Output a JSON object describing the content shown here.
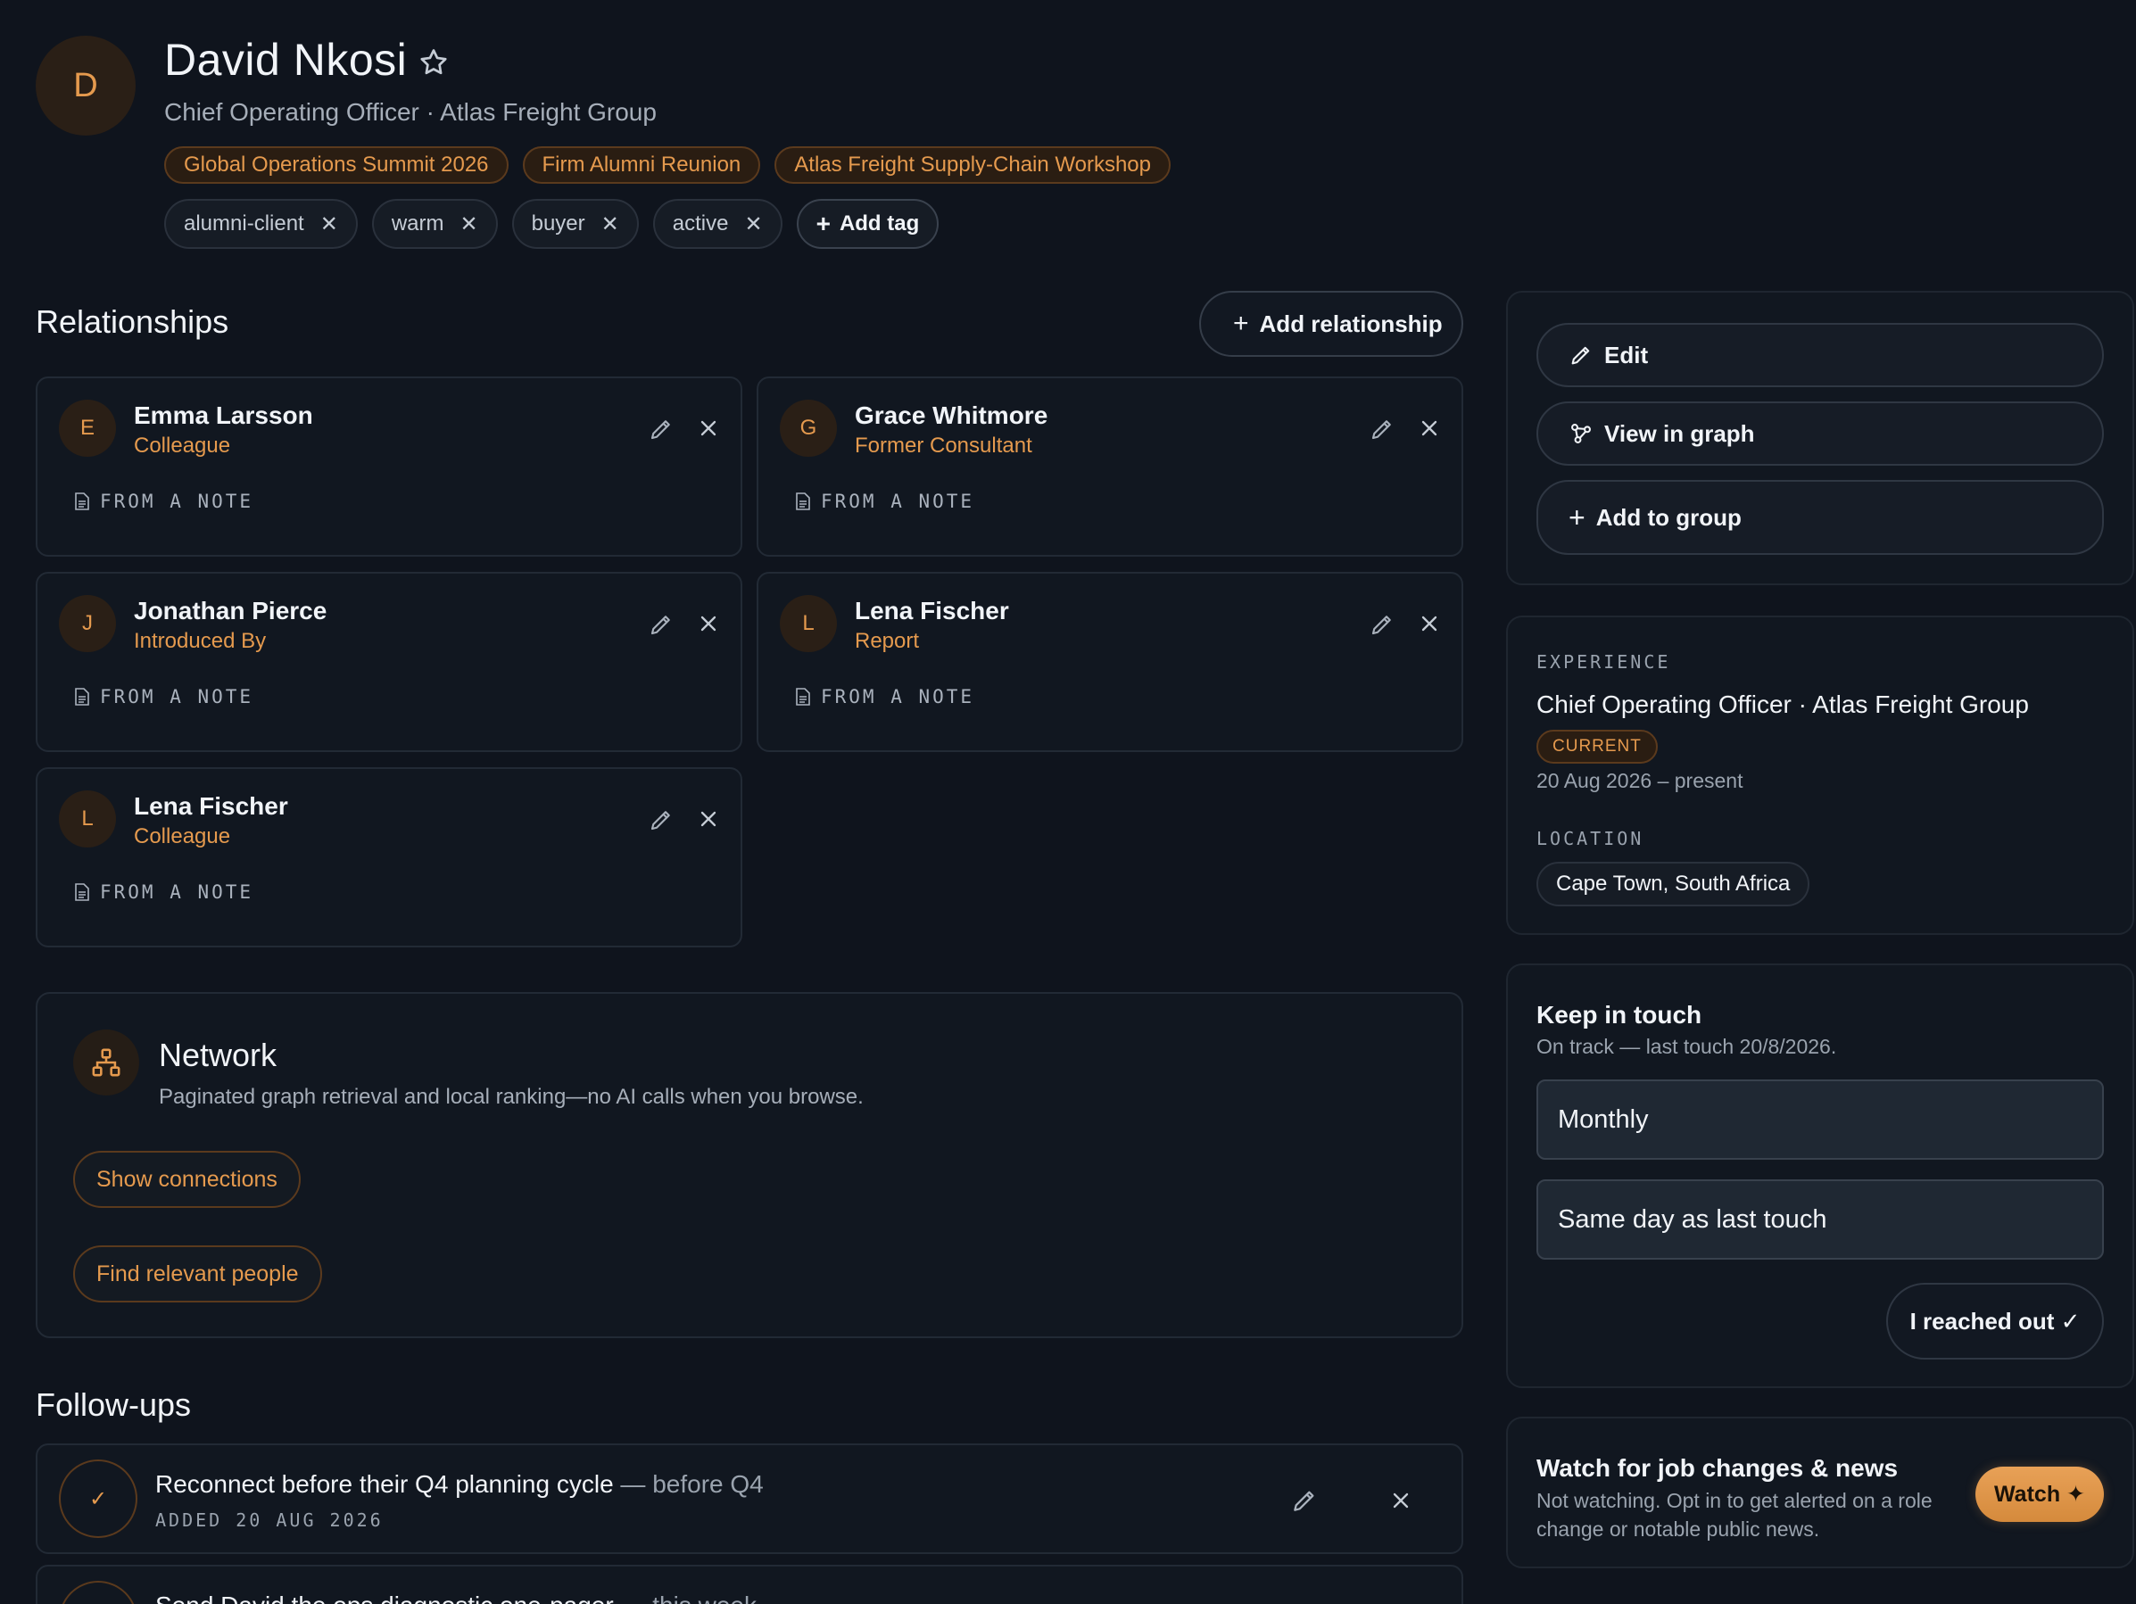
{
  "profile": {
    "avatar_letter": "D",
    "name": "David Nkosi",
    "subtitle": "Chief Operating Officer · Atlas Freight Group",
    "events": [
      "Global Operations Summit 2026",
      "Firm Alumni Reunion",
      "Atlas Freight Supply-Chain Workshop"
    ],
    "tags": [
      "alumni-client",
      "warm",
      "buyer",
      "active"
    ],
    "add_tag_label": "Add tag"
  },
  "relationships": {
    "title": "Relationships",
    "add_label": "Add relationship",
    "source_label": "FROM A NOTE",
    "items": [
      {
        "letter": "E",
        "name": "Emma Larsson",
        "role": "Colleague"
      },
      {
        "letter": "G",
        "name": "Grace Whitmore",
        "role": "Former Consultant"
      },
      {
        "letter": "J",
        "name": "Jonathan Pierce",
        "role": "Introduced By"
      },
      {
        "letter": "L",
        "name": "Lena Fischer",
        "role": "Report"
      },
      {
        "letter": "L",
        "name": "Lena Fischer",
        "role": "Colleague"
      }
    ]
  },
  "network": {
    "title": "Network",
    "description": "Paginated graph retrieval and local ranking—no AI calls when you browse.",
    "show_connections": "Show connections",
    "find_people": "Find relevant people"
  },
  "followups": {
    "title": "Follow-ups",
    "items": [
      {
        "text": "Reconnect before their Q4 planning cycle",
        "due": " — before Q4",
        "added": "ADDED 20 AUG 2026"
      },
      {
        "text": "Send David the ops diagnostic one-pager",
        "due": " — this week",
        "added": ""
      }
    ]
  },
  "actions": {
    "edit": "Edit",
    "view_graph": "View in graph",
    "add_group": "Add to group"
  },
  "experience": {
    "label": "EXPERIENCE",
    "role": "Chief Operating Officer · Atlas Freight Group",
    "badge": "CURRENT",
    "dates": "20 Aug 2026 – present",
    "location_label": "LOCATION",
    "location": "Cape Town, South Africa"
  },
  "keep_in_touch": {
    "title": "Keep in touch",
    "status": "On track — last touch 20/8/2026.",
    "frequency": "Monthly",
    "anchor": "Same day as last touch",
    "reached_out": "I reached out ✓"
  },
  "watch": {
    "title": "Watch for job changes & news",
    "description": "Not watching. Opt in to get alerted on a role change or notable public news.",
    "button": "Watch ✦"
  }
}
